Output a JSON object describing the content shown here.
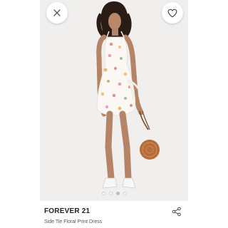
{
  "product": {
    "brand": "FOREVER 21",
    "name": "Side Tie Floral Print Dress"
  },
  "gallery": {
    "slide_count": 4,
    "active_index": 2
  },
  "icons": {
    "close": "close-icon",
    "wishlist": "heart-icon",
    "share": "share-icon"
  },
  "colors": {
    "photo_background": "#efefef",
    "text_primary": "#222222",
    "text_secondary": "#555555"
  }
}
